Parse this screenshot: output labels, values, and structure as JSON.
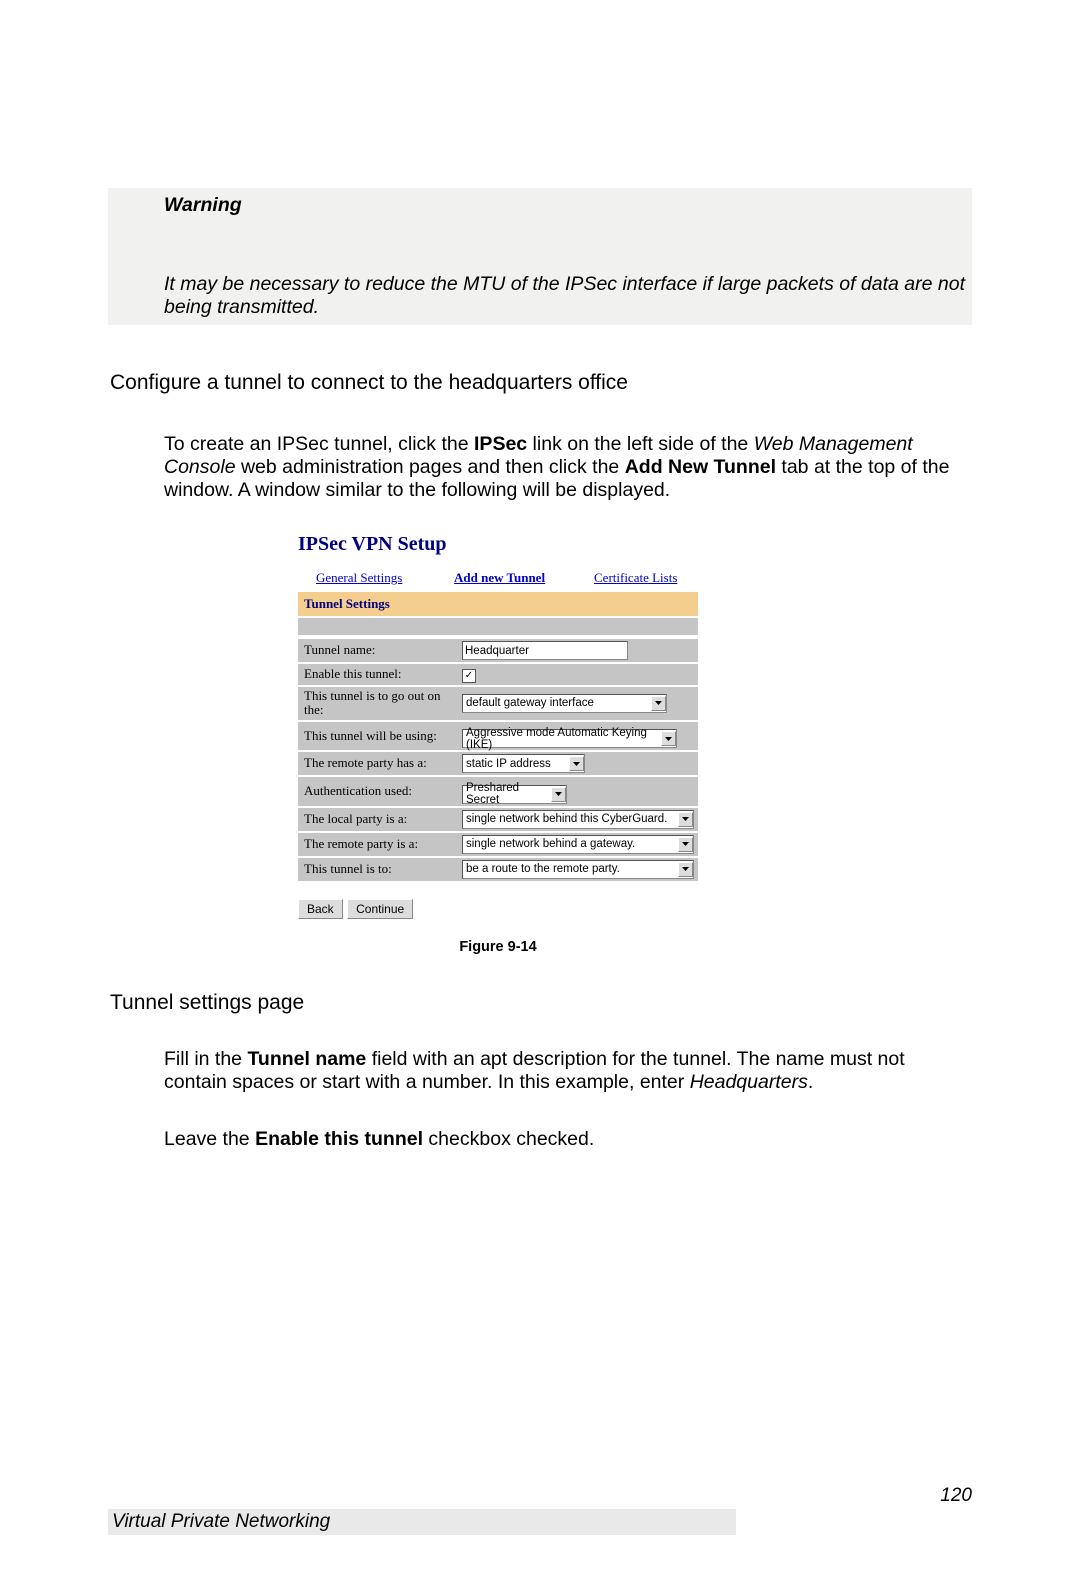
{
  "warning": {
    "title": "Warning",
    "body": "It may be necessary to reduce the MTU of the IPSec interface if large packets of data are not being transmitted."
  },
  "section1_heading": "Configure a tunnel to connect to the headquarters office",
  "para1": {
    "pre": "To create an IPSec tunnel, click the ",
    "b1": "IPSec",
    "mid1": " link on the left side of the ",
    "i1": "Web Management Console",
    "mid2": " web administration pages and then click the ",
    "b2": "Add New Tunnel",
    "post": " tab at the top of the window.  A window similar to the following will be displayed."
  },
  "figure": {
    "title": "IPSec VPN Setup",
    "tabs": {
      "general": "General Settings",
      "add": "Add new Tunnel",
      "cert": "Certificate Lists"
    },
    "section_header": "Tunnel Settings",
    "rows": {
      "tunnel_name_label": "Tunnel name:",
      "tunnel_name_value": "Headquarter",
      "enable_label": "Enable this tunnel:",
      "enable_checked": true,
      "goout_label": "This tunnel is to go out on the:",
      "goout_value": "default gateway interface",
      "using_label": "This tunnel will be using:",
      "using_value": "Aggressive mode Automatic Keying (IKE)",
      "remote_has_label": "The remote party has a:",
      "remote_has_value": "static IP address",
      "auth_label": "Authentication used:",
      "auth_value": "Preshared Secret",
      "local_is_label": "The local party is a:",
      "local_is_value": "single network behind this CyberGuard.",
      "remote_is_label": "The remote party is a:",
      "remote_is_value": "single network behind a gateway.",
      "tunnel_to_label": "This tunnel is to:",
      "tunnel_to_value": "be a route to the remote party."
    },
    "buttons": {
      "back": "Back",
      "continue": "Continue"
    },
    "caption": "Figure 9-14"
  },
  "section2_heading": "Tunnel settings page",
  "para2": {
    "pre": "Fill in the ",
    "b1": "Tunnel name",
    "mid1": " field with an apt description for the tunnel.  The name must not contain spaces or start with a number.  In this example, enter ",
    "i1": "Headquarters",
    "post": "."
  },
  "para3": {
    "pre": "Leave the ",
    "b1": "Enable this tunnel",
    "post": " checkbox checked."
  },
  "footer": {
    "page": "120",
    "chapter": "Virtual Private Networking"
  }
}
